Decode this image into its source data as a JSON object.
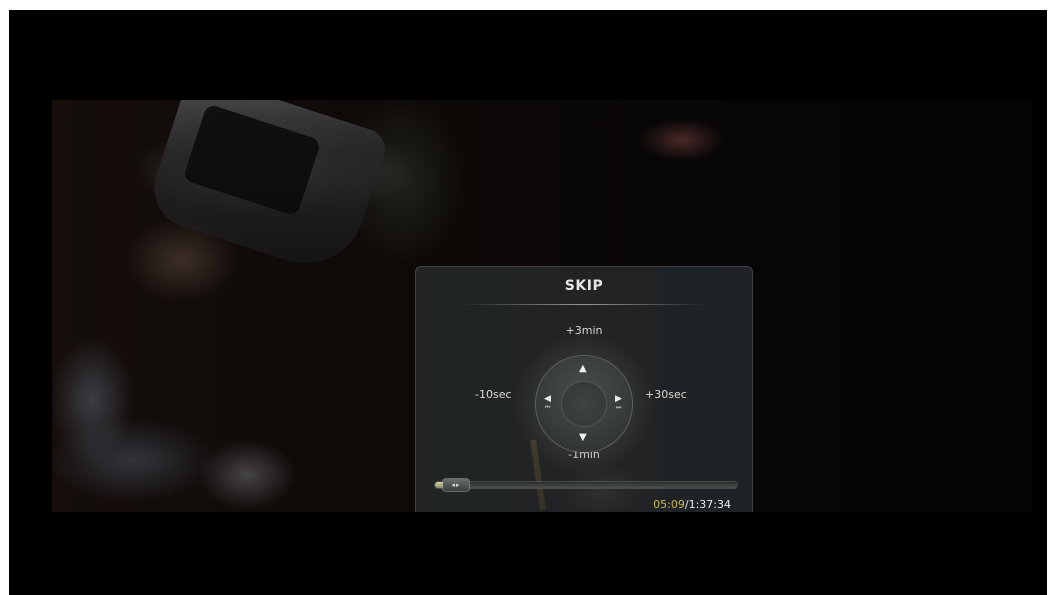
{
  "skip_panel": {
    "title": "SKIP",
    "directions": {
      "up_label": "+3min",
      "down_label": "-1min",
      "left_label": "-10sec",
      "right_label": "+30sec"
    },
    "icons": {
      "up": "arrow-up-icon",
      "down": "arrow-down-icon",
      "left": "arrow-left-icon",
      "right": "arrow-right-icon"
    },
    "progress": {
      "fraction": 0.056,
      "current_time": "05:09",
      "separator": "/",
      "total_time": "1:37:34"
    },
    "colors": {
      "current_time": "#c7b84a",
      "panel_bg": "#282c2e"
    }
  }
}
